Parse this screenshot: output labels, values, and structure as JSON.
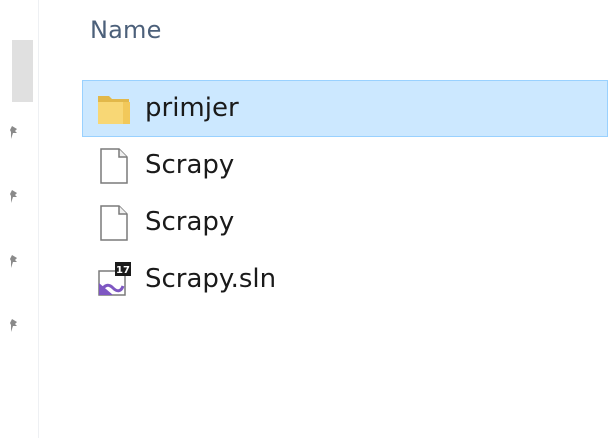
{
  "header": {
    "name_column": "Name"
  },
  "files": [
    {
      "name": "primjer",
      "icon": "folder-icon",
      "selected": true
    },
    {
      "name": "Scrapy",
      "icon": "document-icon",
      "selected": false
    },
    {
      "name": "Scrapy",
      "icon": "document-icon",
      "selected": false
    },
    {
      "name": "Scrapy.sln",
      "icon": "visual-studio-solution-icon",
      "selected": false,
      "badge": "17"
    }
  ],
  "colors": {
    "selection_fill": "#cce8ff",
    "selection_border": "#99d1ff",
    "header_text": "#4c607a",
    "folder_yellow": "#f8d775",
    "vs_purple": "#7e57c2"
  }
}
